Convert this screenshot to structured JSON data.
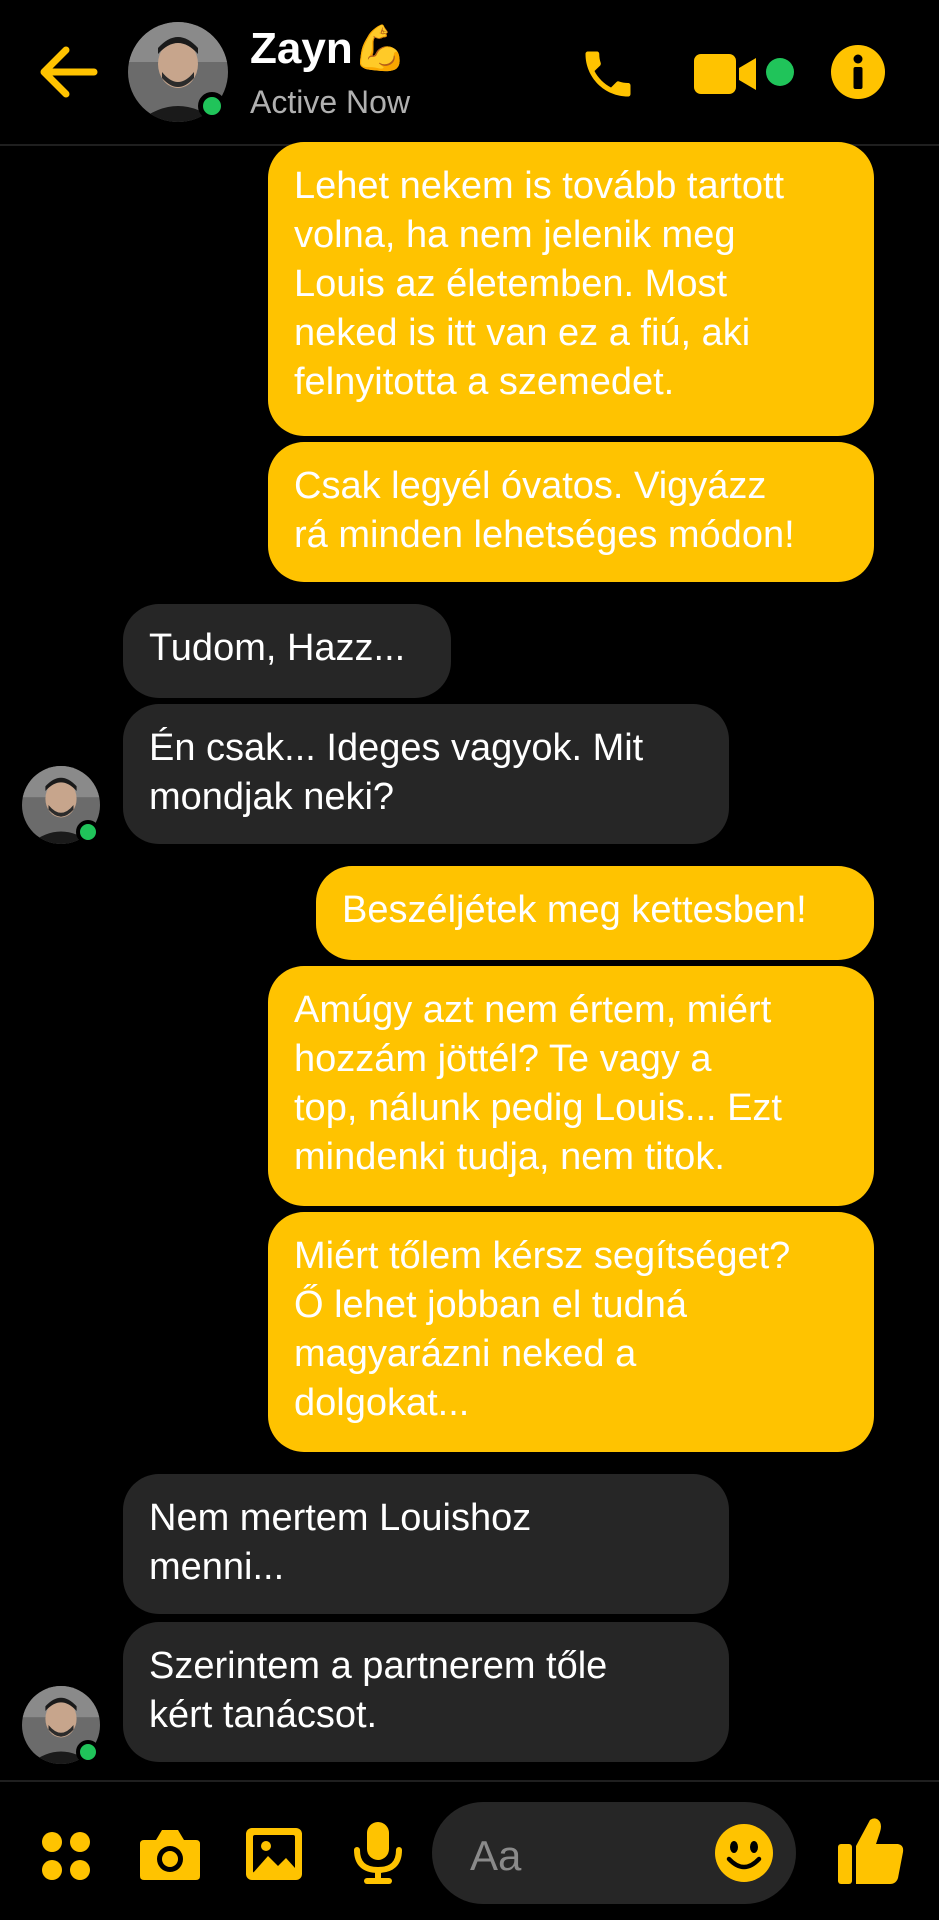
{
  "header": {
    "contact_name": "Zayn",
    "contact_emoji": "💪",
    "status": "Active Now",
    "icons": [
      "back-arrow-icon",
      "phone-icon",
      "video-camera-icon",
      "info-icon"
    ]
  },
  "messages": [
    {
      "side": "sent",
      "text": "Lehet nekem is tovább tartott\nvolna, ha nem jelenik meg\nLouis az életemben. Most\nneked is itt van ez a fiú, aki\nfelnyitotta a szemedet."
    },
    {
      "side": "sent",
      "text": "Csak legyél óvatos. Vigyázz\nrá minden lehetséges módon!"
    },
    {
      "side": "received",
      "text": "Tudom, Hazz..."
    },
    {
      "side": "received",
      "text": "Én csak... Ideges vagyok. Mit\nmondjak neki?"
    },
    {
      "side": "sent",
      "text": "Beszéljétek meg kettesben!"
    },
    {
      "side": "sent",
      "text": "Amúgy azt nem értem, miért\nhozzám jöttél? Te vagy a\ntop, nálunk pedig Louis... Ezt\nmindenki tudja, nem titok."
    },
    {
      "side": "sent",
      "text": "Miért tőlem kérsz segítséget?\nŐ lehet jobban el tudná\nmagyarázni neked a\ndolgokat..."
    },
    {
      "side": "received",
      "text": "Nem mertem Louishoz\nmenni..."
    },
    {
      "side": "received",
      "text": "Szerintem a partnerem tőle\nkért tanácsot."
    }
  ],
  "composer": {
    "placeholder": "Aa",
    "icons": [
      "apps-grid-icon",
      "camera-icon",
      "gallery-icon",
      "microphone-icon",
      "emoji-icon",
      "thumbs-up-icon"
    ]
  },
  "colors": {
    "accent": "#ffc300",
    "received_bubble": "#262626",
    "background": "#000000",
    "online": "#20c45a"
  }
}
